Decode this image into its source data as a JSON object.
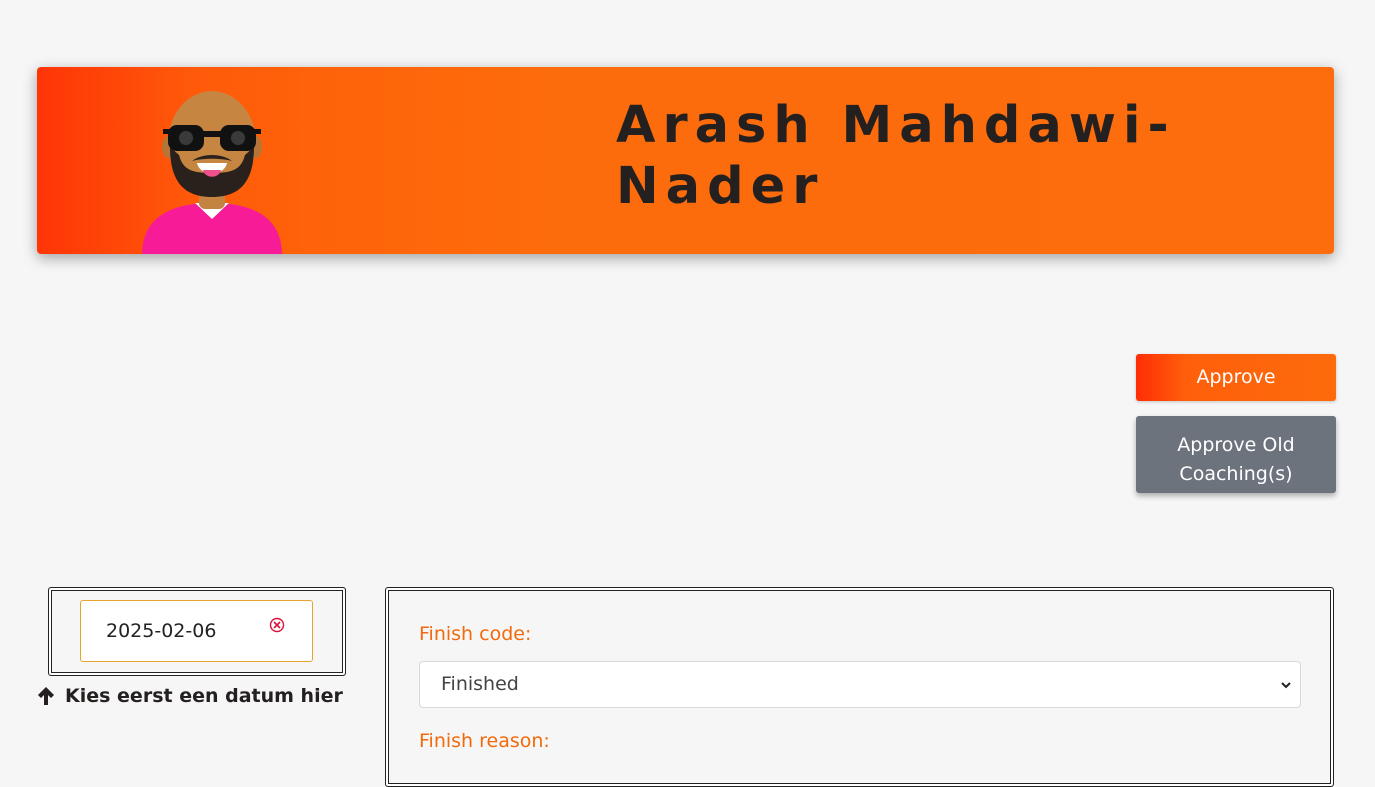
{
  "header": {
    "name": "Arash Mahdawi-Nader",
    "avatar_icon": "avatar-icon"
  },
  "actions": {
    "approve_label": "Approve",
    "approve_old_label": "Approve Old Coaching(s)"
  },
  "date_picker": {
    "value": "2025-02-06",
    "clear_icon": "clear-icon",
    "hint_icon": "arrow-up-icon",
    "hint": "Kies eerst een datum hier"
  },
  "form": {
    "finish_code_label": "Finish code:",
    "finish_code_value": "Finished",
    "finish_reason_label": "Finish reason:"
  },
  "colors": {
    "accent": "#fd6d0d",
    "accent_start": "#ff3407",
    "secondary_button": "#6c737d",
    "label": "#f26a0c",
    "background": "#f6f6f6"
  }
}
